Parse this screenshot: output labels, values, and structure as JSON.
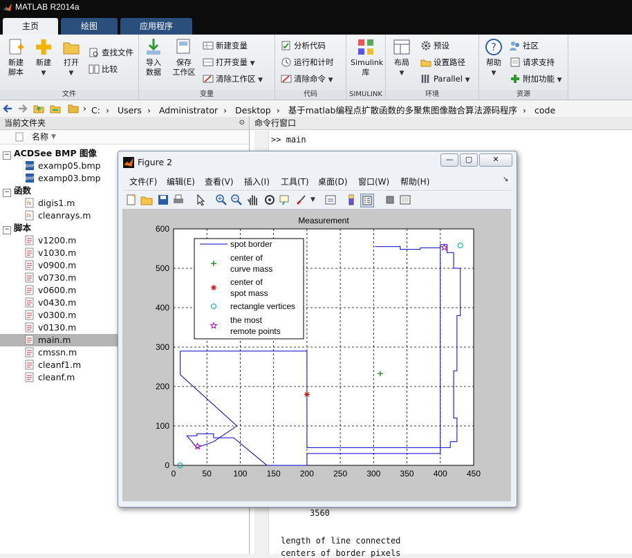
{
  "app": {
    "title": "MATLAB R2014a"
  },
  "ribbon": {
    "tabs": [
      "主页",
      "绘图",
      "应用程序"
    ],
    "groups": {
      "file": {
        "label": "文件",
        "new_script": "新建\n脚本",
        "new": "新建",
        "open": "打开",
        "find_files": "查找文件",
        "compare": "比较"
      },
      "variable": {
        "label": "变量",
        "import": "导入\n数据",
        "save_ws": "保存\n工作区",
        "new_var": "新建变量",
        "open_var": "打开变量",
        "clear_ws": "清除工作区"
      },
      "code": {
        "label": "代码",
        "analyze": "分析代码",
        "run_time": "运行和计时",
        "clear_cmd": "清除命令"
      },
      "simulink": {
        "label": "SIMULINK",
        "lib": "Simulink\n库"
      },
      "env": {
        "label": "环境",
        "layout": "布局",
        "prefs": "预设",
        "set_path": "设置路径",
        "parallel": "Parallel"
      },
      "resources": {
        "label": "资源",
        "help": "帮助",
        "community": "社区",
        "support": "请求支持",
        "addons": "附加功能"
      }
    }
  },
  "address": {
    "crumbs": [
      "C:",
      "Users",
      "Administrator",
      "Desktop",
      "基于matlab编程点扩散函数的多聚焦图像融合算法源码程序",
      "code"
    ]
  },
  "folder_panel": {
    "title": "当前文件夹",
    "column": "名称",
    "sections": [
      {
        "name": "ACDSee BMP 图像",
        "files": [
          "examp05.bmp",
          "examp03.bmp"
        ],
        "type": "bmp"
      },
      {
        "name": "函数",
        "files": [
          "digis1.m",
          "cleanrays.m"
        ],
        "type": "func"
      },
      {
        "name": "脚本",
        "files": [
          "v1200.m",
          "v1030.m",
          "v0900.m",
          "v0730.m",
          "v0600.m",
          "v0430.m",
          "v0300.m",
          "v0130.m",
          "main.m",
          "cmssn.m",
          "cleanf1.m",
          "cleanf.m"
        ],
        "type": "script"
      }
    ],
    "selected": "main.m"
  },
  "command_window": {
    "title": "命令行窗口",
    "prompt": ">>",
    "command": "main",
    "output_number": "3560",
    "output_line1": "length of line connected",
    "output_line2": "centers of border pixels"
  },
  "figure": {
    "title": "Figure 2",
    "menu": [
      "文件(F)",
      "编辑(E)",
      "查看(V)",
      "插入(I)",
      "工具(T)",
      "桌面(D)",
      "窗口(W)",
      "帮助(H)"
    ],
    "buttons": {
      "min": "—",
      "max": "▢",
      "close": "✕"
    }
  },
  "chart_data": {
    "type": "line",
    "title": "Measurement",
    "xlabel": "",
    "ylabel": "",
    "xlim": [
      0,
      450
    ],
    "ylim": [
      0,
      600
    ],
    "xticks": [
      0,
      50,
      100,
      150,
      200,
      250,
      300,
      350,
      400,
      450
    ],
    "yticks": [
      0,
      100,
      200,
      300,
      400,
      500,
      600
    ],
    "grid": true,
    "legend_position": "top-left",
    "colors": {
      "border": "#0000cc",
      "curve_mass": "#008000",
      "spot_mass": "#cc0000",
      "vertices": "#00aaaa",
      "remote": "#b000b0"
    },
    "series": [
      {
        "name": "spot border",
        "style": "line",
        "points": [
          [
            10,
            290
          ],
          [
            200,
            290
          ],
          [
            200,
            45
          ],
          [
            400,
            45
          ],
          [
            400,
            560
          ],
          [
            410,
            560
          ],
          [
            410,
            540
          ],
          [
            420,
            540
          ],
          [
            420,
            500
          ],
          [
            430,
            500
          ],
          [
            430,
            380
          ],
          [
            425,
            380
          ],
          [
            425,
            240
          ],
          [
            420,
            240
          ],
          [
            420,
            120
          ],
          [
            425,
            120
          ],
          [
            425,
            60
          ],
          [
            415,
            60
          ],
          [
            415,
            45
          ],
          [
            400,
            45
          ],
          [
            400,
            30
          ],
          [
            200,
            30
          ],
          [
            200,
            0
          ],
          [
            140,
            0
          ],
          [
            90,
            70
          ],
          [
            60,
            70
          ],
          [
            60,
            80
          ],
          [
            35,
            80
          ],
          [
            35,
            75
          ],
          [
            20,
            75
          ],
          [
            35,
            45
          ],
          [
            60,
            60
          ],
          [
            95,
            100
          ],
          [
            10,
            230
          ],
          [
            10,
            290
          ]
        ]
      },
      {
        "name": "center of\ncurve mass",
        "style": "marker",
        "marker": "+",
        "points": [
          [
            310,
            233
          ]
        ]
      },
      {
        "name": "center of\nspot mass",
        "style": "marker",
        "marker": "*",
        "points": [
          [
            200,
            180
          ]
        ]
      },
      {
        "name": "rectangle vertices",
        "style": "marker",
        "marker": "o",
        "points": [
          [
            10,
            0
          ],
          [
            430,
            558
          ]
        ]
      },
      {
        "name": "the most\nremote points",
        "style": "marker",
        "marker": "star",
        "points": [
          [
            36,
            48
          ],
          [
            406,
            553
          ]
        ]
      }
    ],
    "top_border_points": [
      [
        302,
        555
      ],
      [
        340,
        555
      ],
      [
        340,
        548
      ],
      [
        370,
        548
      ],
      [
        370,
        552
      ],
      [
        400,
        552
      ]
    ]
  }
}
